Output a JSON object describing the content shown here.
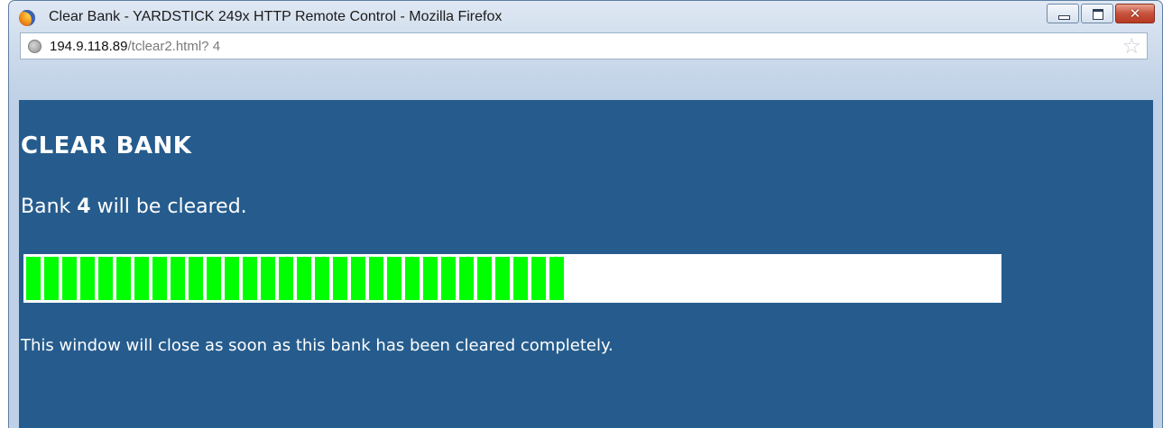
{
  "window": {
    "title": "Clear Bank - YARDSTICK 249x HTTP Remote Control - Mozilla Firefox",
    "app_icon": "firefox-icon",
    "controls": {
      "minimize_icon": "minimize-icon",
      "maximize_icon": "maximize-icon",
      "close_icon": "close-icon",
      "close_glyph": "✕"
    }
  },
  "address_bar": {
    "host": "194.9.118.89",
    "path": "/tclear2.html? 4",
    "site_icon": "globe-icon",
    "bookmark_icon": "star-icon",
    "bookmark_glyph": "☆"
  },
  "page": {
    "heading": "CLEAR BANK",
    "bank_prefix": "Bank ",
    "bank_number": "4",
    "bank_suffix": " will be cleared.",
    "progress": {
      "filled_segments": 30,
      "total_segments": 54,
      "fraction": 0.556,
      "fill_color": "#00ff00",
      "track_color": "#ffffff"
    },
    "note": "This window will close as soon as this bank has been cleared completely.",
    "background_color": "#265c8d"
  }
}
